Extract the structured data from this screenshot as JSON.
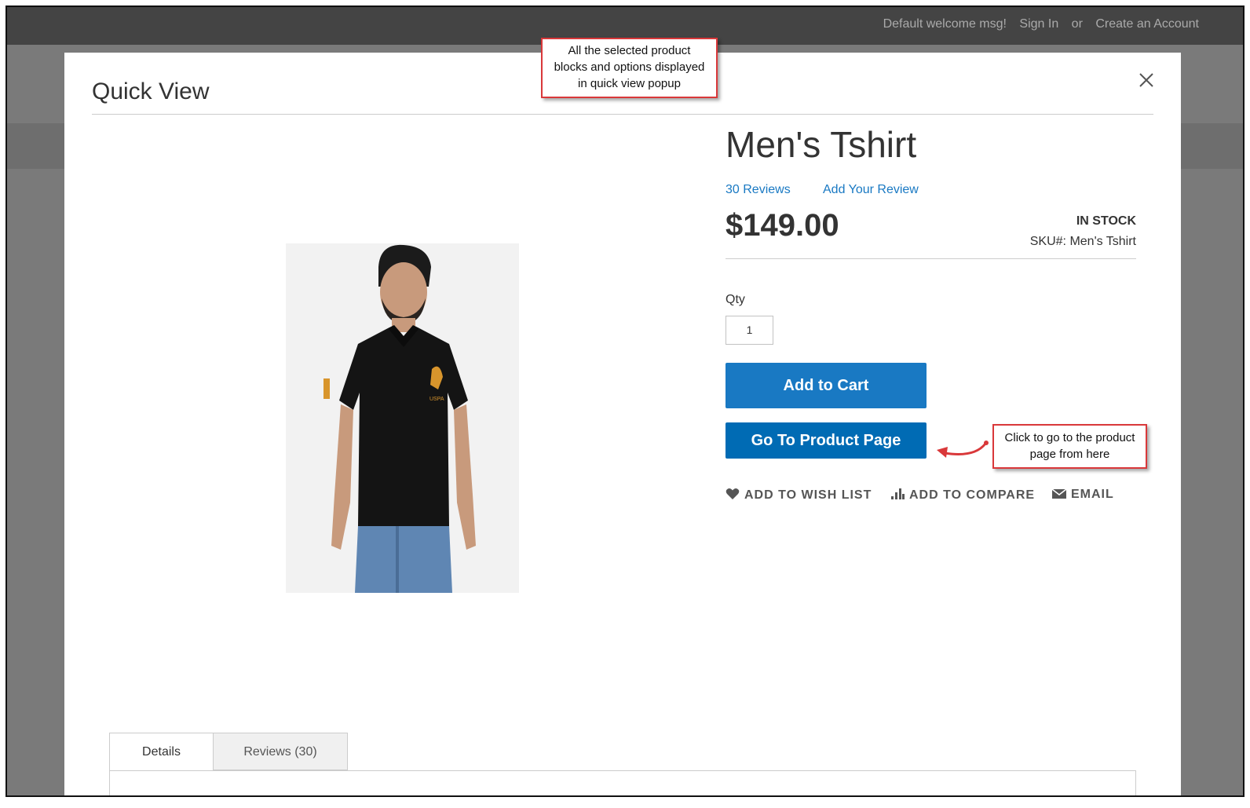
{
  "topbar": {
    "welcome": "Default welcome msg!",
    "sign_in": "Sign In",
    "or": "or",
    "create_account": "Create an Account"
  },
  "modal": {
    "title": "Quick View",
    "close_icon": "close-icon"
  },
  "product": {
    "name": "Men's Tshirt",
    "reviews_link": "30  Reviews",
    "add_review_link": "Add Your Review",
    "price": "$149.00",
    "stock": "IN STOCK",
    "sku": "SKU#:  Men's Tshirt",
    "qty_label": "Qty",
    "qty_value": "1",
    "add_to_cart": "Add to Cart",
    "go_to_product_page": "Go To Product Page",
    "actions": [
      {
        "label": "ADD TO WISH LIST",
        "icon": "heart-icon"
      },
      {
        "label": "ADD TO COMPARE",
        "icon": "compare-icon"
      },
      {
        "label": "EMAIL",
        "icon": "envelope-icon"
      }
    ]
  },
  "tabs": [
    {
      "label": "Details",
      "active": true
    },
    {
      "label": "Reviews (30)",
      "active": false
    }
  ],
  "annotations": {
    "top": [
      "All the selected product",
      "blocks and options displayed",
      "in quick view popup"
    ],
    "right": [
      "Click to go to the product",
      "page from here"
    ]
  },
  "colors": {
    "link": "#1979c3",
    "primary_button": "#1979c3",
    "secondary_button": "#006bb4",
    "callout_border": "#d9383a"
  }
}
